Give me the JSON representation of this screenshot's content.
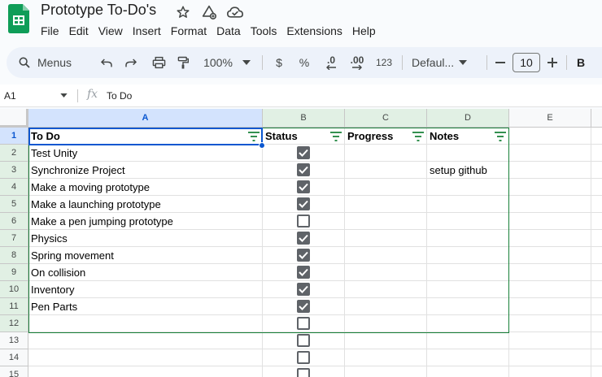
{
  "app": {
    "doc_title": "Prototype To-Do's",
    "menu": [
      "File",
      "Edit",
      "View",
      "Insert",
      "Format",
      "Data",
      "Tools",
      "Extensions",
      "Help"
    ]
  },
  "toolbar": {
    "search_label": "Menus",
    "zoom": "100%",
    "currency": "$",
    "percent": "%",
    "decrease_decimal": ".0",
    "increase_decimal": ".00",
    "number_format": "123",
    "font": "Defaul...",
    "font_size": "10",
    "bold": "B"
  },
  "formula": {
    "cell_ref": "A1",
    "fx": "fx",
    "value": "To Do"
  },
  "sheet": {
    "columns": [
      "A",
      "B",
      "C",
      "D",
      "E"
    ],
    "headers": {
      "a": "To Do",
      "b": "Status",
      "c": "Progress",
      "d": "Notes"
    },
    "row_numbers": [
      "1",
      "2",
      "3",
      "4",
      "5",
      "6",
      "7",
      "8",
      "9",
      "10",
      "11",
      "12",
      "13",
      "14",
      "15"
    ],
    "rows": [
      {
        "task": "Test Unity",
        "done": true,
        "notes": ""
      },
      {
        "task": "Synchronize Project",
        "done": true,
        "notes": "setup github"
      },
      {
        "task": "Make a moving prototype",
        "done": true,
        "notes": ""
      },
      {
        "task": "Make a launching prototype",
        "done": true,
        "notes": ""
      },
      {
        "task": "Make a pen jumping prototype",
        "done": false,
        "notes": ""
      },
      {
        "task": "Physics",
        "done": true,
        "notes": ""
      },
      {
        "task": "Spring movement",
        "done": true,
        "notes": ""
      },
      {
        "task": "On collision",
        "done": true,
        "notes": ""
      },
      {
        "task": "Inventory",
        "done": true,
        "notes": ""
      },
      {
        "task": "Pen Parts",
        "done": true,
        "notes": ""
      },
      {
        "task": "",
        "done": false,
        "notes": ""
      },
      {
        "task": "",
        "done": false,
        "notes": ""
      },
      {
        "task": "",
        "done": false,
        "notes": ""
      },
      {
        "task": "",
        "done": false,
        "notes": ""
      }
    ]
  },
  "colors": {
    "accent_blue": "#0b57d0",
    "range_green": "#188038",
    "sheets_green": "#0f9d58"
  }
}
